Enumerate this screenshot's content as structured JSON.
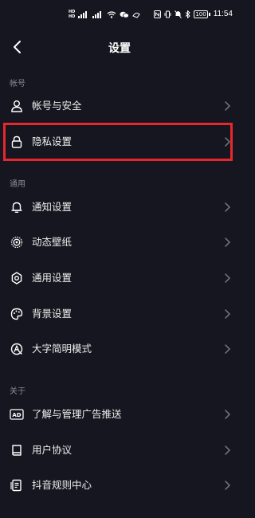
{
  "status_bar": {
    "network_badge_top": "HD",
    "network_badge_bottom": "HD",
    "signal_label_1": "5G",
    "signal_label_2": "4G",
    "time": "11:54",
    "battery": "100"
  },
  "header": {
    "title": "设置"
  },
  "sections": [
    {
      "label": "帐号",
      "items": [
        {
          "label": "帐号与安全",
          "icon": "person-icon"
        },
        {
          "label": "隐私设置",
          "icon": "lock-icon",
          "highlighted": true
        }
      ]
    },
    {
      "label": "通用",
      "items": [
        {
          "label": "通知设置",
          "icon": "bell-icon"
        },
        {
          "label": "动态壁纸",
          "icon": "wallpaper-icon"
        },
        {
          "label": "通用设置",
          "icon": "gear-icon"
        },
        {
          "label": "背景设置",
          "icon": "palette-icon"
        },
        {
          "label": "大字简明模式",
          "icon": "font-size-icon"
        }
      ]
    },
    {
      "label": "关于",
      "items": [
        {
          "label": "了解与管理广告推送",
          "icon": "ad-icon"
        },
        {
          "label": "用户协议",
          "icon": "book-icon"
        },
        {
          "label": "抖音规则中心",
          "icon": "document-icon"
        }
      ]
    }
  ],
  "colors": {
    "background": "#15161f",
    "highlight": "#e8262d",
    "section_label": "#8a8b92"
  }
}
